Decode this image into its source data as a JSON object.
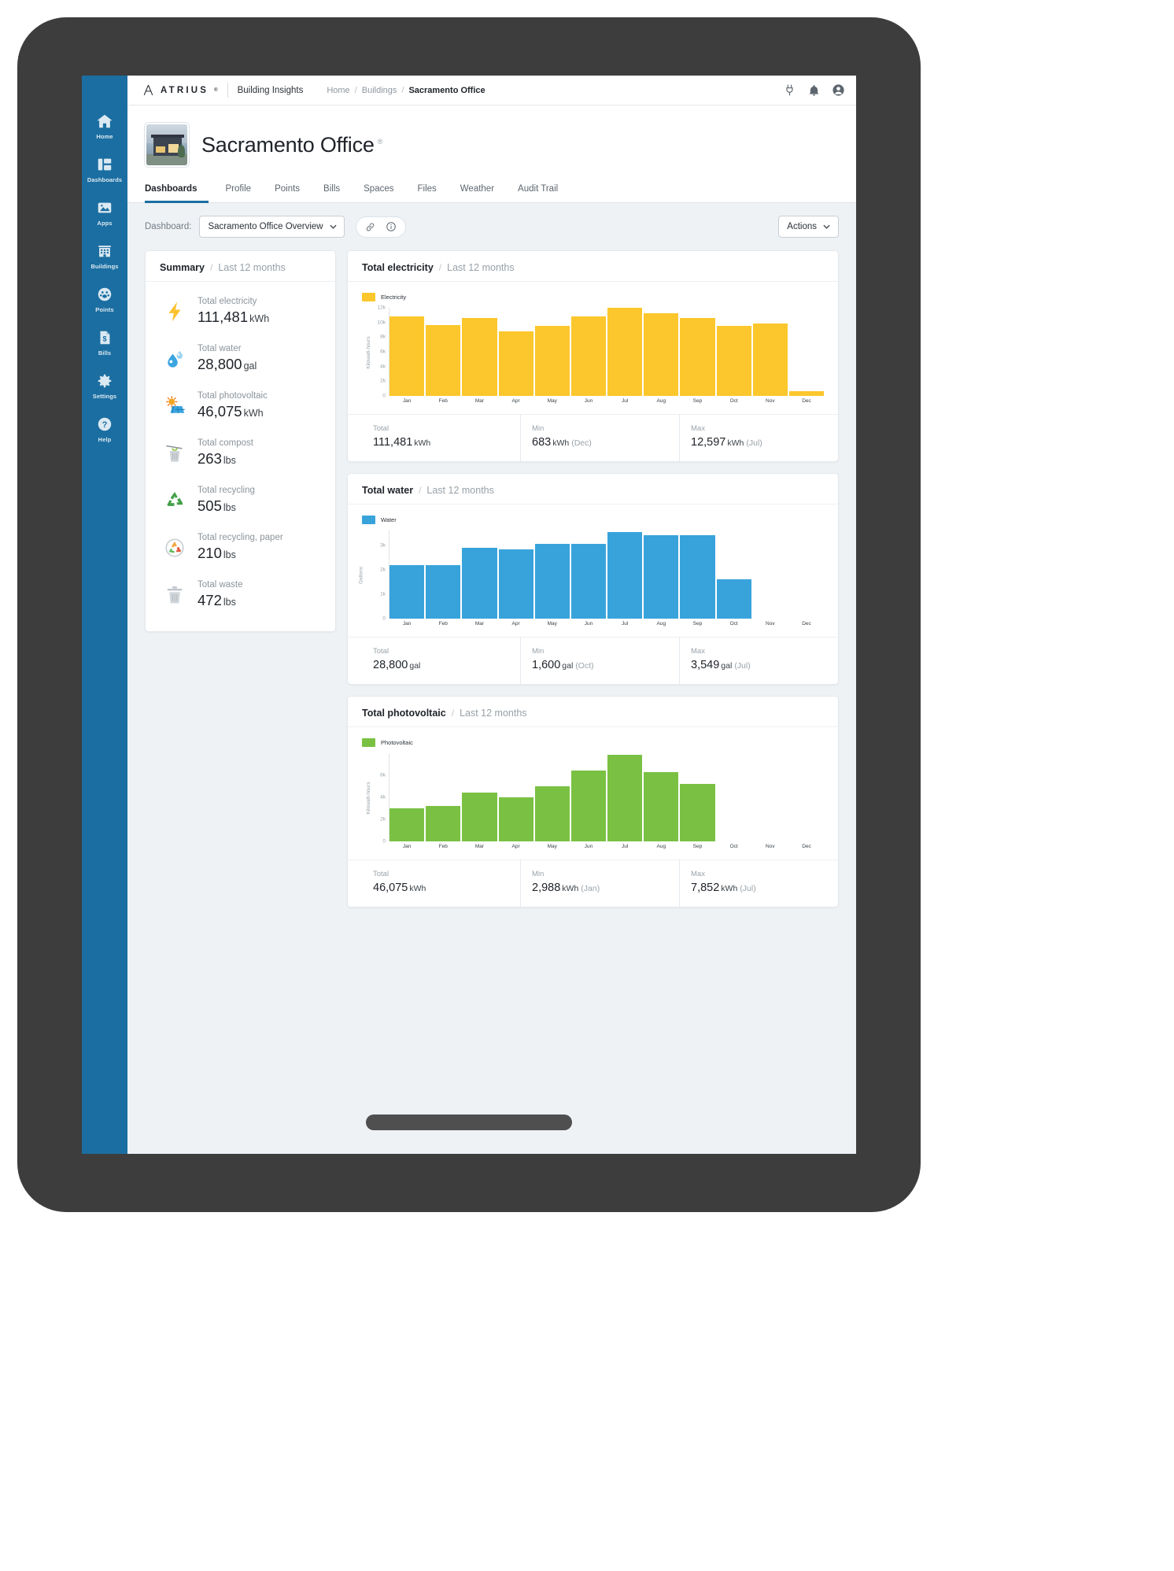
{
  "topbar": {
    "brand": "ATRIUS",
    "brand_tm": "®",
    "product": "Building Insights",
    "breadcrumb": [
      "Home",
      "Buildings",
      "Sacramento Office"
    ],
    "icons": [
      "plug-icon",
      "bell-icon",
      "user-avatar-icon"
    ]
  },
  "sidebar": {
    "items": [
      {
        "label": "Home",
        "icon": "home-icon"
      },
      {
        "label": "Dashboards",
        "icon": "dashboards-icon"
      },
      {
        "label": "Apps",
        "icon": "apps-icon"
      },
      {
        "label": "Buildings",
        "icon": "buildings-icon"
      },
      {
        "label": "Points",
        "icon": "points-icon"
      },
      {
        "label": "Bills",
        "icon": "bills-icon"
      },
      {
        "label": "Settings",
        "icon": "gear-icon"
      },
      {
        "label": "Help",
        "icon": "help-icon"
      }
    ]
  },
  "page": {
    "title": "Sacramento Office",
    "title_badge": "®",
    "thumbnail_alt": "building-photo"
  },
  "tabs": [
    {
      "label": "Dashboards",
      "active": true
    },
    {
      "label": "Profile",
      "active": false
    },
    {
      "label": "Points",
      "active": false
    },
    {
      "label": "Bills",
      "active": false
    },
    {
      "label": "Spaces",
      "active": false
    },
    {
      "label": "Files",
      "active": false
    },
    {
      "label": "Weather",
      "active": false
    },
    {
      "label": "Audit Trail",
      "active": false
    }
  ],
  "toolbar": {
    "dashboard_label": "Dashboard:",
    "dashboard_value": "Sacramento Office Overview",
    "link_icon": "link-icon",
    "info_icon": "info-icon",
    "actions_label": "Actions"
  },
  "summary": {
    "title": "Summary",
    "separator": "/",
    "subtitle": "Last 12 months",
    "items": [
      {
        "label": "Total electricity",
        "value": "111,481",
        "unit": "kWh",
        "icon": "lightning-bolt-icon"
      },
      {
        "label": "Total water",
        "value": "28,800",
        "unit": "gal",
        "icon": "water-drop-icon"
      },
      {
        "label": "Total photovoltaic",
        "value": "46,075",
        "unit": "kWh",
        "icon": "solar-panel-icon"
      },
      {
        "label": "Total compost",
        "value": "263",
        "unit": "lbs",
        "icon": "compost-bin-icon"
      },
      {
        "label": "Total recycling",
        "value": "505",
        "unit": "lbs",
        "icon": "recycling-icon"
      },
      {
        "label": "Total recycling, paper",
        "value": "210",
        "unit": "lbs",
        "icon": "paper-recycling-icon"
      },
      {
        "label": "Total waste",
        "value": "472",
        "unit": "lbs",
        "icon": "trash-bin-icon"
      }
    ]
  },
  "cards": [
    {
      "title": "Total electricity",
      "separator": "/",
      "subtitle": "Last 12 months",
      "color": "#fcc72c",
      "stats": [
        {
          "label": "Total",
          "value": "111,481",
          "unit": "kWh",
          "note": ""
        },
        {
          "label": "Min",
          "value": "683",
          "unit": "kWh",
          "note": "(Dec)"
        },
        {
          "label": "Max",
          "value": "12,597",
          "unit": "kWh",
          "note": "(Jul)"
        }
      ]
    },
    {
      "title": "Total water",
      "separator": "/",
      "subtitle": "Last 12 months",
      "color": "#38a3db",
      "stats": [
        {
          "label": "Total",
          "value": "28,800",
          "unit": "gal",
          "note": ""
        },
        {
          "label": "Min",
          "value": "1,600",
          "unit": "gal",
          "note": "(Oct)"
        },
        {
          "label": "Max",
          "value": "3,549",
          "unit": "gal",
          "note": "(Jul)"
        }
      ]
    },
    {
      "title": "Total photovoltaic",
      "separator": "/",
      "subtitle": "Last 12 months",
      "color": "#7ac143",
      "stats": [
        {
          "label": "Total",
          "value": "46,075",
          "unit": "kWh",
          "note": ""
        },
        {
          "label": "Min",
          "value": "2,988",
          "unit": "kWh",
          "note": "(Jan)"
        },
        {
          "label": "Max",
          "value": "7,852",
          "unit": "kWh",
          "note": "(Jul)"
        }
      ]
    }
  ],
  "chart_data": [
    {
      "type": "bar",
      "title": "Total electricity",
      "subtitle": "Last 12 months",
      "legend": [
        "Electricity"
      ],
      "legend_position": "top-left",
      "color": "#fcc72c",
      "xlabel": "",
      "ylabel": "Kilowatt-hours",
      "categories": [
        "Jan",
        "Feb",
        "Mar",
        "Apr",
        "May",
        "Jun",
        "Jul",
        "Aug",
        "Sep",
        "Oct",
        "Nov",
        "Dec"
      ],
      "values": [
        10820,
        9620,
        10600,
        8760,
        9560,
        10800,
        12597,
        11200,
        10600,
        9500,
        9900,
        683
      ],
      "ylim": [
        0,
        12000
      ],
      "yticks": [
        0,
        2000,
        4000,
        6000,
        8000,
        10000,
        12000
      ],
      "ytick_labels": [
        "0",
        "2k",
        "4k",
        "6k",
        "8k",
        "10k",
        "12k"
      ],
      "grid": false
    },
    {
      "type": "bar",
      "title": "Total water",
      "subtitle": "Last 12 months",
      "legend": [
        "Water"
      ],
      "legend_position": "top-left",
      "color": "#38a3db",
      "xlabel": "",
      "ylabel": "Gallons",
      "categories": [
        "Jan",
        "Feb",
        "Mar",
        "Apr",
        "May",
        "Jun",
        "Jul",
        "Aug",
        "Sep",
        "Oct",
        "Nov",
        "Dec"
      ],
      "values": [
        2180,
        2180,
        2880,
        2830,
        3050,
        3050,
        3549,
        3400,
        3400,
        1600,
        0,
        0
      ],
      "ylim": [
        0,
        3600
      ],
      "yticks": [
        0,
        1000,
        2000,
        3000
      ],
      "ytick_labels": [
        "0",
        "1k",
        "2k",
        "3k"
      ],
      "grid": false
    },
    {
      "type": "bar",
      "title": "Total photovoltaic",
      "subtitle": "Last 12 months",
      "legend": [
        "Photovoltaic"
      ],
      "legend_position": "top-left",
      "color": "#7ac143",
      "xlabel": "",
      "ylabel": "Kilowatt-hours",
      "categories": [
        "Jan",
        "Feb",
        "Mar",
        "Apr",
        "May",
        "Jun",
        "Jul",
        "Aug",
        "Sep",
        "Oct",
        "Nov",
        "Dec"
      ],
      "values": [
        2988,
        3250,
        4450,
        4000,
        5000,
        6400,
        7852,
        6300,
        5200,
        0,
        0,
        0
      ],
      "ylim": [
        0,
        8000
      ],
      "yticks": [
        0,
        2000,
        4000,
        6000
      ],
      "ytick_labels": [
        "0",
        "2k",
        "4k",
        "6k"
      ],
      "grid": false
    }
  ]
}
